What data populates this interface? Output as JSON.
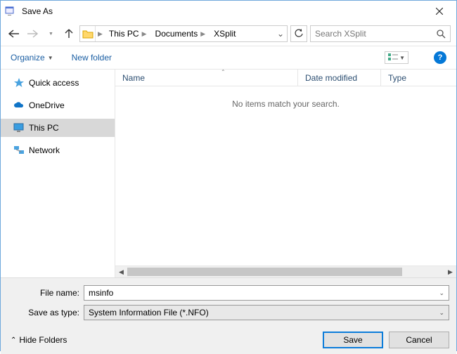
{
  "title": "Save As",
  "breadcrumb": [
    "This PC",
    "Documents",
    "XSplit"
  ],
  "search_placeholder": "Search XSplit",
  "toolbar": {
    "organize": "Organize",
    "new_folder": "New folder"
  },
  "sidebar": {
    "items": [
      {
        "label": "Quick access"
      },
      {
        "label": "OneDrive"
      },
      {
        "label": "This PC"
      },
      {
        "label": "Network"
      }
    ]
  },
  "columns": {
    "name": "Name",
    "date": "Date modified",
    "type": "Type"
  },
  "empty_message": "No items match your search.",
  "filename_label": "File name:",
  "filename_value": "msinfo",
  "filetype_label": "Save as type:",
  "filetype_value": "System Information File (*.NFO)",
  "hide_folders": "Hide Folders",
  "save": "Save",
  "cancel": "Cancel"
}
